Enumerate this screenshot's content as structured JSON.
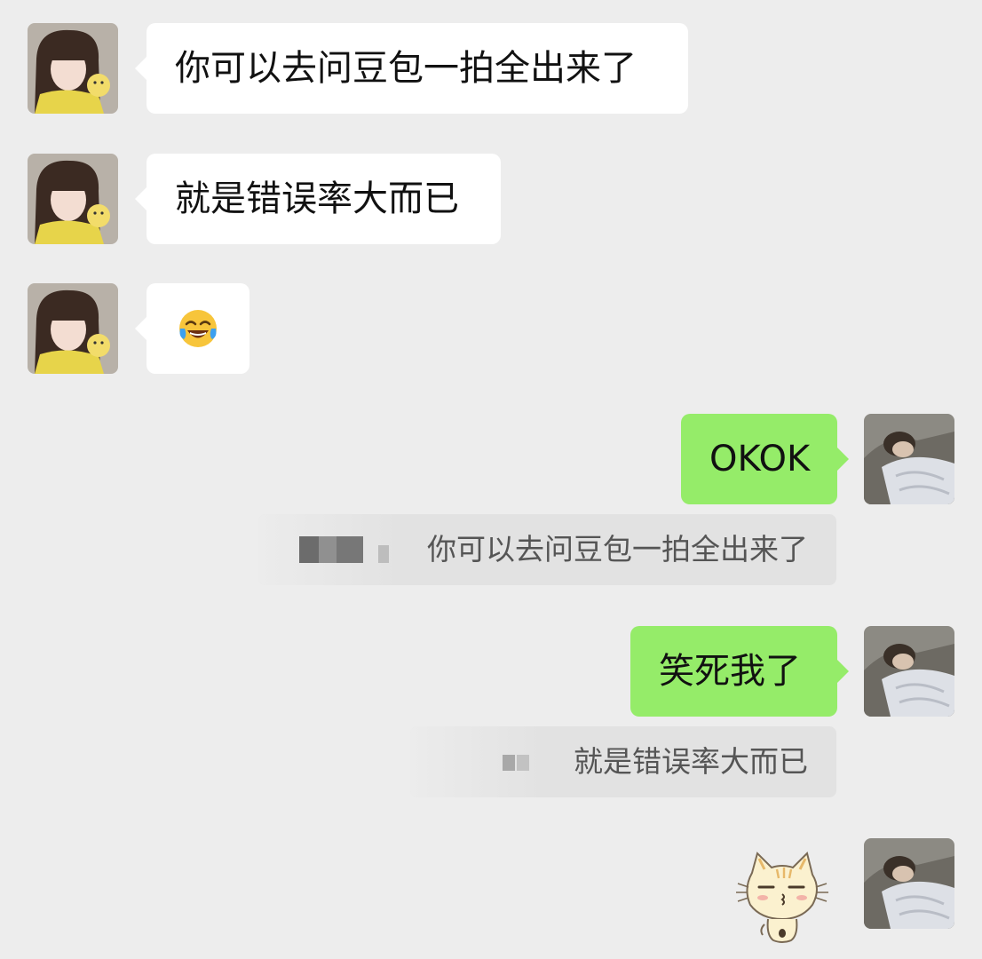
{
  "conversation": {
    "messages": [
      {
        "side": "in",
        "text": "你可以去问豆包一拍全出来了"
      },
      {
        "side": "in",
        "text": "就是错误率大而已"
      },
      {
        "side": "in",
        "emoji": "face-with-tears-of-joy"
      },
      {
        "side": "out",
        "text": "OKOK",
        "quote": "你可以去问豆包一拍全出来了"
      },
      {
        "side": "out",
        "text": "笑死我了",
        "quote": "就是错误率大而已"
      },
      {
        "side": "out",
        "sticker": "cat-sticker"
      }
    ]
  },
  "colors": {
    "background": "#ededed",
    "incoming_bubble": "#ffffff",
    "outgoing_bubble": "#95ec69",
    "quote_bg": "#e2e2e2"
  }
}
